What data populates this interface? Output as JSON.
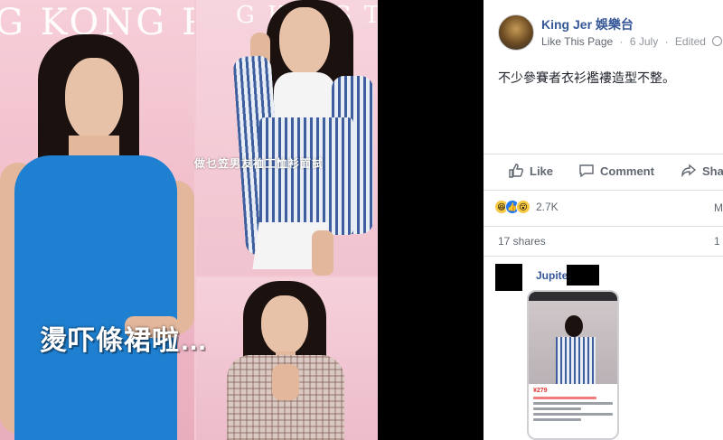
{
  "photo": {
    "background_title_left": "G KONG P",
    "background_title_right": "G KONG TAG",
    "caption_small": "做乜笠男友裇工恤衫面試",
    "caption_big": "燙吓條裙啦…"
  },
  "post": {
    "page_name": "King Jer 娛樂台",
    "like_link": "Like This Page",
    "date": "6 July",
    "edited": "Edited",
    "text": "不少參賽者衣衫襤褸造型不整。"
  },
  "actions": {
    "like": "Like",
    "comment": "Comment",
    "share": "Sha"
  },
  "stats": {
    "reaction_count": "2.7K",
    "right_cut_top": "M",
    "shares": "17 shares",
    "right_cut_bottom": "1"
  },
  "comment": {
    "name": "Jupite",
    "price": "¥279"
  },
  "colors": {
    "facebook_blue": "#365899",
    "dress_blue": "#1f7fd0",
    "pink_bg": "#f3c9d4"
  }
}
